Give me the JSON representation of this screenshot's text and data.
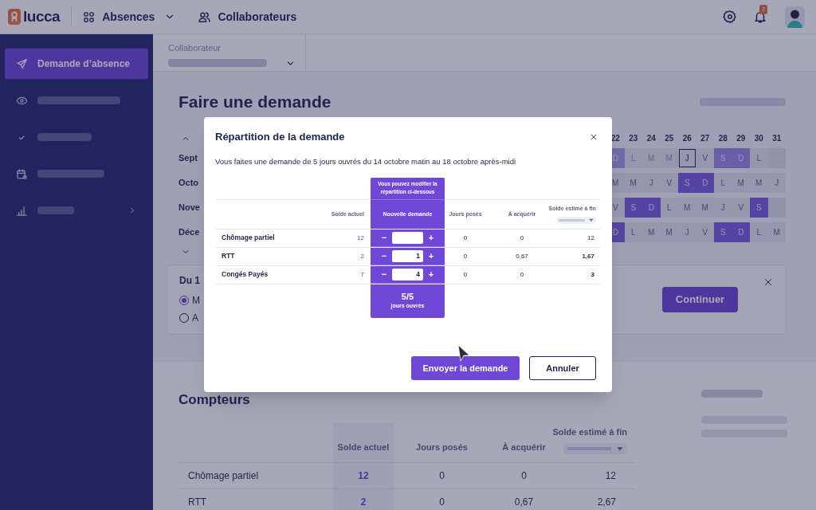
{
  "topbar": {
    "logo": "lucca",
    "nav": [
      {
        "label": "Absences",
        "kind": "apps",
        "dropdown": true
      },
      {
        "label": "Collaborateurs",
        "kind": "people",
        "dropdown": false
      }
    ],
    "notifications": "2"
  },
  "sidebar": {
    "items": [
      {
        "label": "Demande d’absence",
        "selected": true,
        "expandable": false
      },
      {
        "selected": false,
        "expandable": false
      },
      {
        "selected": false,
        "expandable": false
      },
      {
        "selected": false,
        "expandable": false
      },
      {
        "selected": false,
        "expandable": true
      }
    ]
  },
  "filter": {
    "label": "Collaborateur"
  },
  "page_title": "Faire une demande",
  "calendar": {
    "days": [
      "22",
      "23",
      "24",
      "25",
      "26",
      "27",
      "28",
      "29",
      "30",
      "31"
    ],
    "months": [
      {
        "name": "Sept",
        "cells": [
          {
            "letter": "D",
            "kind": "past_weekend"
          },
          {
            "letter": "L",
            "kind": "past"
          },
          {
            "letter": "M",
            "kind": "past"
          },
          {
            "letter": "M",
            "kind": "past"
          },
          {
            "letter": "J",
            "kind": "today"
          },
          {
            "letter": "V",
            "kind": "weekday"
          },
          {
            "letter": "S",
            "kind": "soft_weekend"
          },
          {
            "letter": "D",
            "kind": "soft_weekend"
          },
          {
            "letter": "L",
            "kind": "weekday"
          },
          {
            "kind": "empty"
          }
        ]
      },
      {
        "name": "Octo",
        "cells": [
          {
            "letter": "M",
            "kind": "weekday"
          },
          {
            "letter": "M",
            "kind": "weekday"
          },
          {
            "letter": "J",
            "kind": "weekday"
          },
          {
            "letter": "V",
            "kind": "weekday"
          },
          {
            "letter": "S",
            "kind": "weekend"
          },
          {
            "letter": "D",
            "kind": "weekend"
          },
          {
            "letter": "L",
            "kind": "weekday"
          },
          {
            "letter": "M",
            "kind": "weekday"
          },
          {
            "letter": "M",
            "kind": "weekday"
          },
          {
            "letter": "J",
            "kind": "weekday"
          }
        ]
      },
      {
        "name": "Nove",
        "cells": [
          {
            "letter": "V",
            "kind": "weekday"
          },
          {
            "letter": "S",
            "kind": "weekend"
          },
          {
            "letter": "D",
            "kind": "weekend"
          },
          {
            "letter": "L",
            "kind": "weekday"
          },
          {
            "letter": "M",
            "kind": "weekday"
          },
          {
            "letter": "M",
            "kind": "weekday"
          },
          {
            "letter": "J",
            "kind": "weekday"
          },
          {
            "letter": "V",
            "kind": "weekday"
          },
          {
            "letter": "S",
            "kind": "weekend"
          },
          {
            "kind": "empty"
          }
        ]
      },
      {
        "name": "Déce",
        "cells": [
          {
            "letter": "D",
            "kind": "weekend"
          },
          {
            "letter": "L",
            "kind": "weekday"
          },
          {
            "letter": "M",
            "kind": "weekday"
          },
          {
            "letter": "M",
            "kind": "weekday"
          },
          {
            "letter": "J",
            "kind": "weekday"
          },
          {
            "letter": "V",
            "kind": "weekday"
          },
          {
            "letter": "S",
            "kind": "weekend"
          },
          {
            "letter": "D",
            "kind": "weekend"
          },
          {
            "letter": "L",
            "kind": "weekday"
          },
          {
            "letter": "M",
            "kind": "weekday"
          }
        ]
      }
    ]
  },
  "selection": {
    "title": "Du 1",
    "options": [
      {
        "label": "M",
        "selected": true
      },
      {
        "label": "A",
        "selected": false
      }
    ],
    "button": "Continuer"
  },
  "counters": {
    "title": "Compteurs",
    "columns": [
      "Solde actuel",
      "Jours posés",
      "À acquérir",
      "Solde estimé à fin"
    ],
    "rows": [
      {
        "name": "Chômage partiel",
        "balance": "12",
        "taken": "0",
        "to_acquire": "0",
        "estimate": "12"
      },
      {
        "name": "RTT",
        "balance": "2",
        "taken": "0",
        "to_acquire": "0,67",
        "estimate": "2,67"
      }
    ]
  },
  "modal": {
    "title": "Répartition de la demande",
    "intro": "Vous faites une demande de 5 jours ouvrés du 14 octobre matin au 18 octobre après-midi",
    "hint": "Vous pouvez modifier la répartition ci-dessous",
    "columns": [
      "Solde actuel",
      "Nouvelle demande",
      "Jours posés",
      "À acquérir",
      "Solde estimé à fin"
    ],
    "rows": [
      {
        "name": "Chômage partiel",
        "balance": "12",
        "decrement": "−",
        "increment": "+",
        "taken": "0",
        "to_acquire": "0",
        "estimate": "12",
        "estimate_bold": false
      },
      {
        "name": "RTT",
        "balance": "2",
        "decrement": "−",
        "requested": "1",
        "increment": "+",
        "taken": "0",
        "to_acquire": "0,67",
        "estimate": "1,67",
        "estimate_bold": true
      },
      {
        "name": "Congés Payés",
        "balance": "7",
        "decrement": "−",
        "requested": "4",
        "increment": "+",
        "taken": "0",
        "to_acquire": "0",
        "estimate": "3",
        "estimate_bold": true
      }
    ],
    "total": "5/5",
    "total_label": "jours ouvrés",
    "submit": "Envoyer la demande",
    "cancel": "Annuler"
  }
}
